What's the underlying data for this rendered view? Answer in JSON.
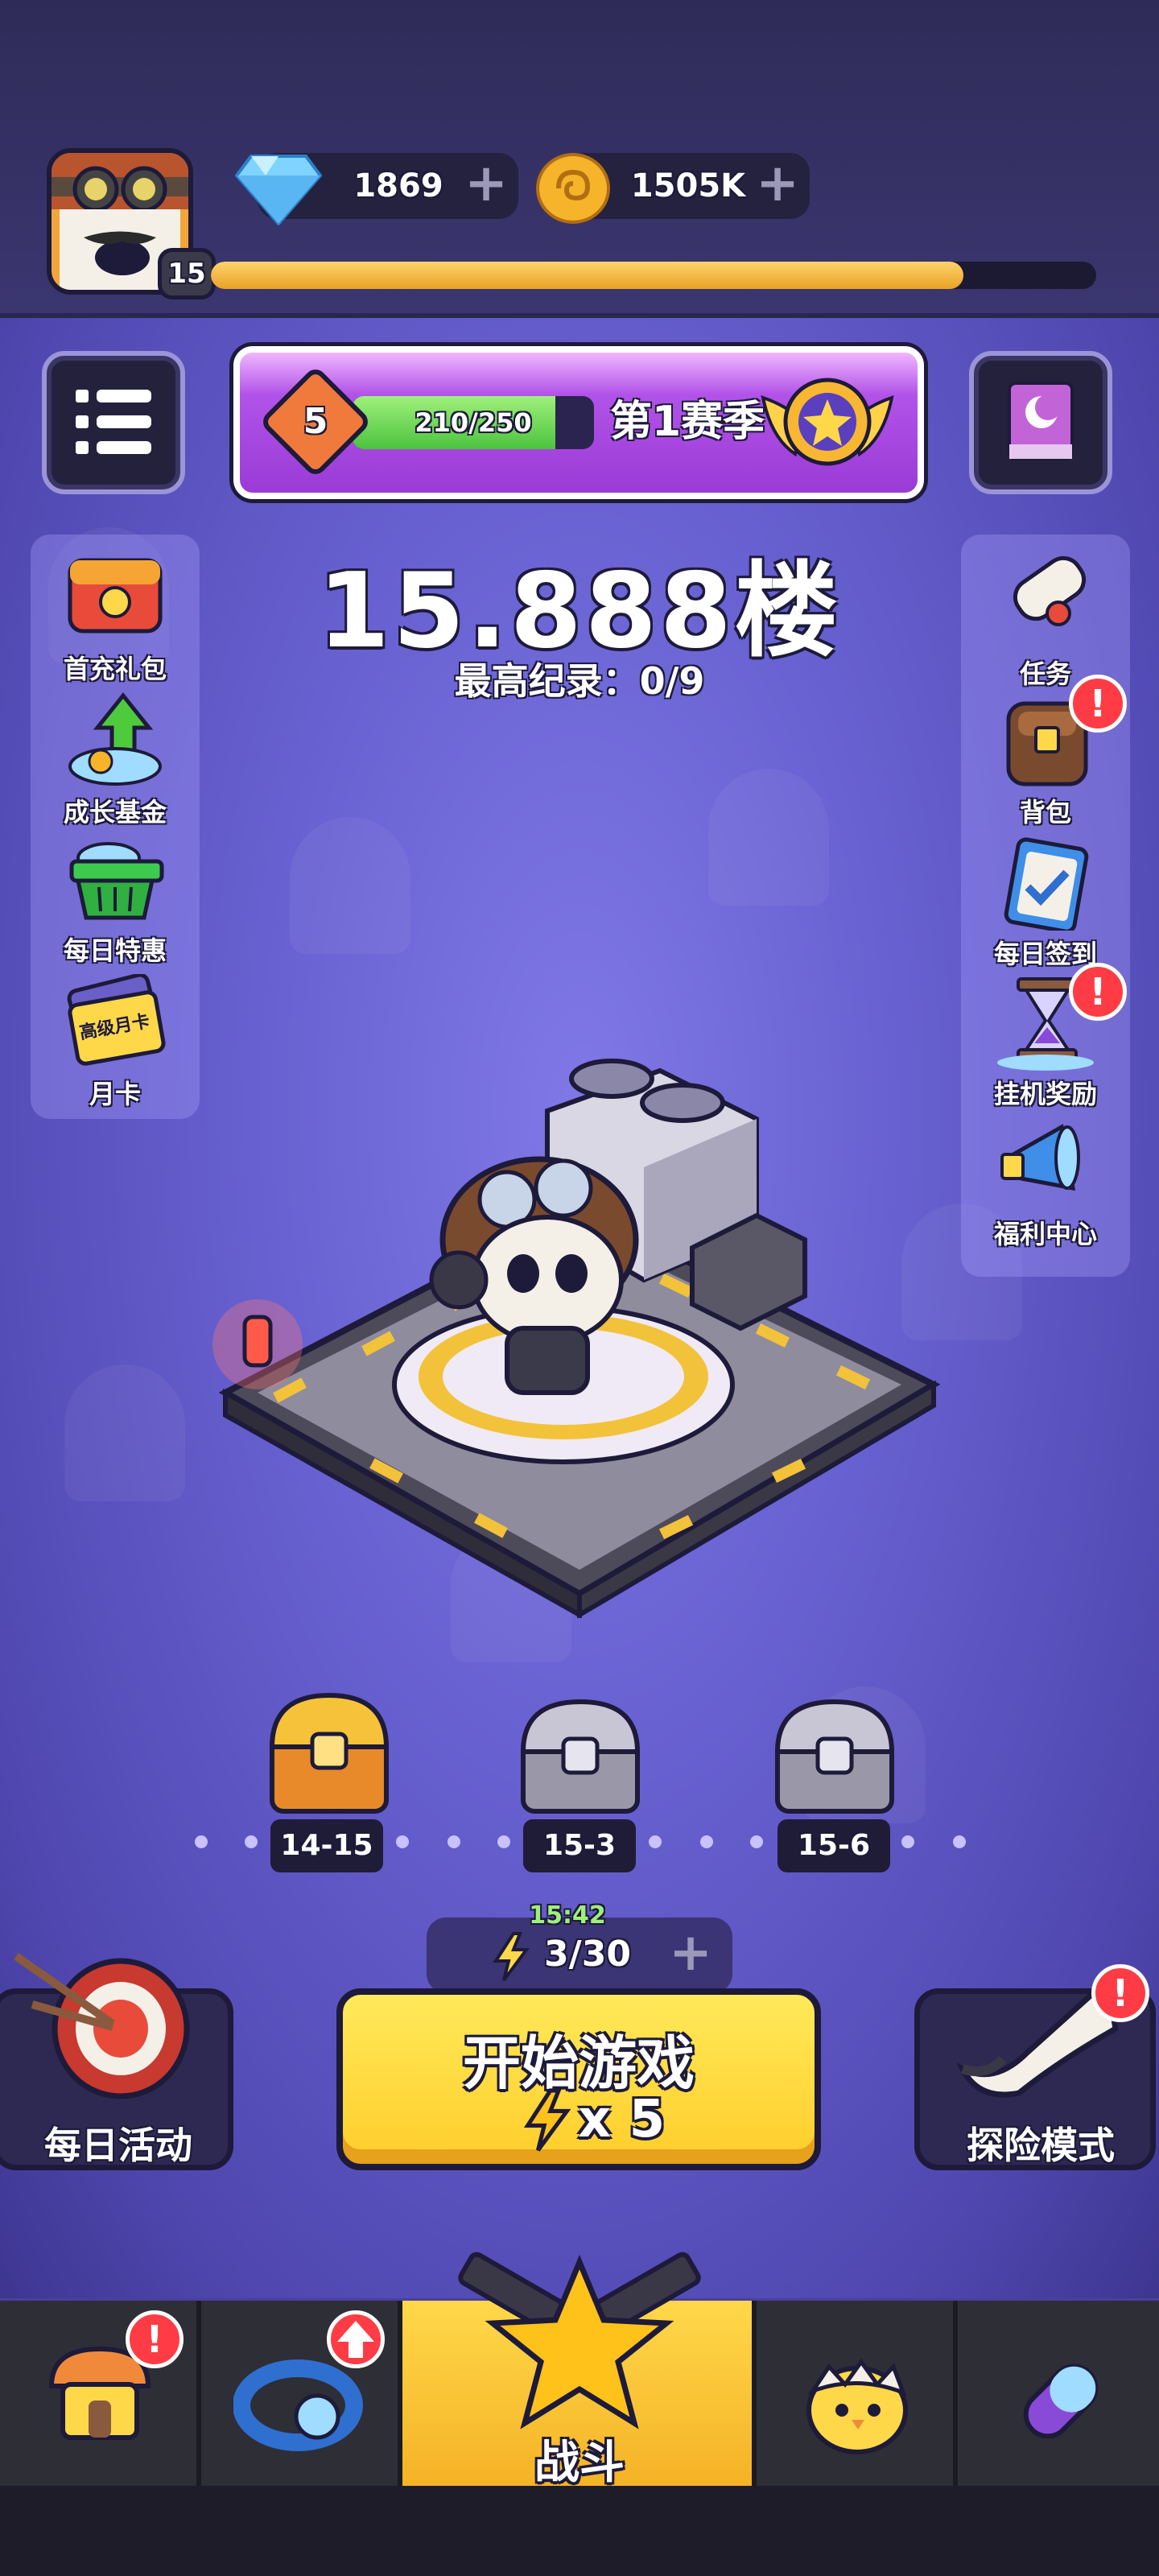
{
  "header": {
    "level": "15",
    "xp_progress": 0.85,
    "gems": "1869",
    "gold": "1505K"
  },
  "season": {
    "rank": "5",
    "progress_text": "210/250",
    "progress": 0.84,
    "title": "第1赛季"
  },
  "stage": {
    "floor_title": "15.888楼",
    "best_record": "最高纪录：0/9"
  },
  "left_menu": [
    {
      "label": "首充礼包",
      "icon": "gift-box-icon"
    },
    {
      "label": "成长基金",
      "icon": "growth-fund-icon"
    },
    {
      "label": "每日特惠",
      "icon": "shopping-basket-icon"
    },
    {
      "label": "月卡",
      "icon": "month-card-icon",
      "card_text": "高级月卡"
    }
  ],
  "right_menu": [
    {
      "label": "任务",
      "icon": "scroll-icon",
      "alert": false
    },
    {
      "label": "背包",
      "icon": "backpack-icon",
      "alert": true
    },
    {
      "label": "每日签到",
      "icon": "checkin-clipboard-icon",
      "alert": false
    },
    {
      "label": "挂机奖励",
      "icon": "hourglass-icon",
      "alert": true
    },
    {
      "label": "福利中心",
      "icon": "megaphone-icon",
      "alert": false
    }
  ],
  "chests": [
    {
      "label": "14-15",
      "type": "gold"
    },
    {
      "label": "15-3",
      "type": "silver"
    },
    {
      "label": "15-6",
      "type": "silver"
    }
  ],
  "energy": {
    "timer": "15:42",
    "value": "3/30"
  },
  "start_button": {
    "label": "开始游戏",
    "cost": "x 5"
  },
  "modes": {
    "daily_label": "每日活动",
    "adventure_label": "探险模式",
    "alert_mark": "!"
  },
  "nav": {
    "battle_label": "战斗",
    "alert_mark": "!"
  },
  "colors": {
    "accent_yellow": "#ffd84a",
    "alert_red": "#ff3c45",
    "background_purple": "#6760d0"
  }
}
